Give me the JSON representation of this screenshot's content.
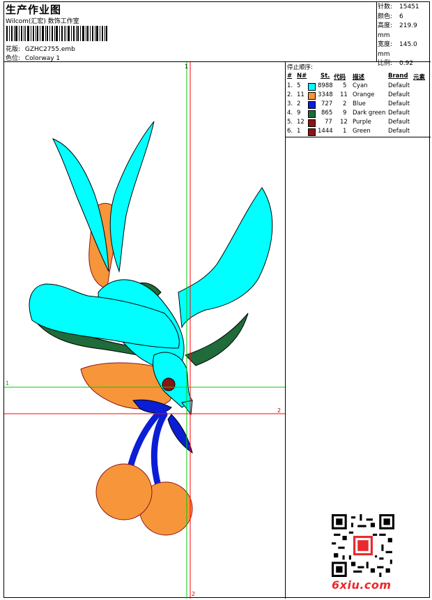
{
  "header": {
    "title": "生产作业图",
    "company": "Wilcom(汇宏) 数饰工作室",
    "design_label": "花版:",
    "design_value": "GZHC2755.emb",
    "colorway_label": "色位:",
    "colorway_value": "Colorway 1"
  },
  "stats": {
    "stitches_label": "针数:",
    "stitches_value": "15451",
    "colors_label": "颜色:",
    "colors_value": "6",
    "height_label": "高度:",
    "height_value": "219.9 mm",
    "width_label": "宽度:",
    "width_value": "145.0 mm",
    "scale_label": "比例:",
    "scale_value": "0.92"
  },
  "legend": {
    "title": "停止顺序:",
    "headers": {
      "num": "#",
      "n": "N#",
      "st": "St.",
      "code": "代码",
      "desc": "描述",
      "brand": "Brand",
      "elem": "元素"
    },
    "rows": [
      {
        "idx": "1.",
        "n": "5",
        "color": "#00ffff",
        "st": "8988",
        "code": "5",
        "desc": "Cyan",
        "brand": "Default"
      },
      {
        "idx": "2.",
        "n": "11",
        "color": "#f7953b",
        "st": "3348",
        "code": "11",
        "desc": "Orange",
        "brand": "Default"
      },
      {
        "idx": "3.",
        "n": "2",
        "color": "#0b1ed6",
        "st": "727",
        "code": "2",
        "desc": "Blue",
        "brand": "Default"
      },
      {
        "idx": "4.",
        "n": "9",
        "color": "#1f6b3a",
        "st": "865",
        "code": "9",
        "desc": "Dark green",
        "brand": "Default"
      },
      {
        "idx": "5.",
        "n": "12",
        "color": "#8c1414",
        "st": "77",
        "code": "12",
        "desc": "Purple",
        "brand": "Default"
      },
      {
        "idx": "6.",
        "n": "1",
        "color": "#8c1414",
        "st": "1444",
        "code": "1",
        "desc": "Green",
        "brand": "Default"
      }
    ]
  },
  "guides": {
    "green_v": "1",
    "green_h": "1",
    "red_h": "2",
    "red_v": "2"
  },
  "watermark": "6xiu.com"
}
